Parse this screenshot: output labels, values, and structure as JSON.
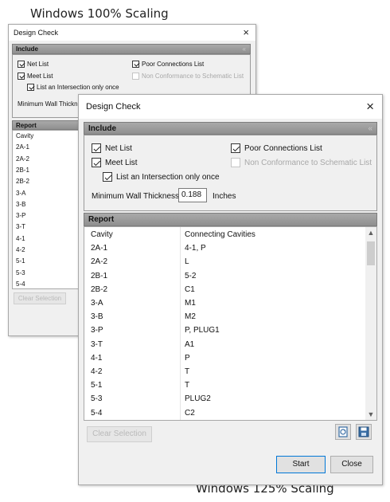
{
  "captions": {
    "top": "Windows 100% Scaling",
    "bottom": "Windows 125% Scaling"
  },
  "dialog": {
    "title": "Design Check",
    "close_glyph": "×",
    "include": {
      "header": "Include",
      "chevron": "«",
      "net_list": "Net List",
      "meet_list": "Meet List",
      "list_intersection": "List an Intersection only once",
      "poor_connections": "Poor Connections List",
      "non_conformance": "Non Conformance to Schematic List",
      "min_wall_label": "Minimum Wall Thickness",
      "min_wall_label_small": "Minimum Wall Thicknes",
      "min_wall_value": "0.188",
      "min_wall_unit": "Inches"
    },
    "report": {
      "header": "Report",
      "columns": [
        "Cavity",
        "Connecting Cavities"
      ],
      "rows": [
        [
          "2A-1",
          "4-1, P"
        ],
        [
          "2A-2",
          "L"
        ],
        [
          "2B-1",
          "5-2"
        ],
        [
          "2B-2",
          "C1"
        ],
        [
          "3-A",
          "M1"
        ],
        [
          "3-B",
          "M2"
        ],
        [
          "3-P",
          "P, PLUG1"
        ],
        [
          "3-T",
          "A1"
        ],
        [
          "4-1",
          "P"
        ],
        [
          "4-2",
          "T"
        ],
        [
          "5-1",
          "T"
        ],
        [
          "5-3",
          "PLUG2"
        ],
        [
          "5-4",
          "C2"
        ]
      ]
    },
    "clear_selection": "Clear Selection",
    "start": "Start",
    "close": "Close"
  }
}
